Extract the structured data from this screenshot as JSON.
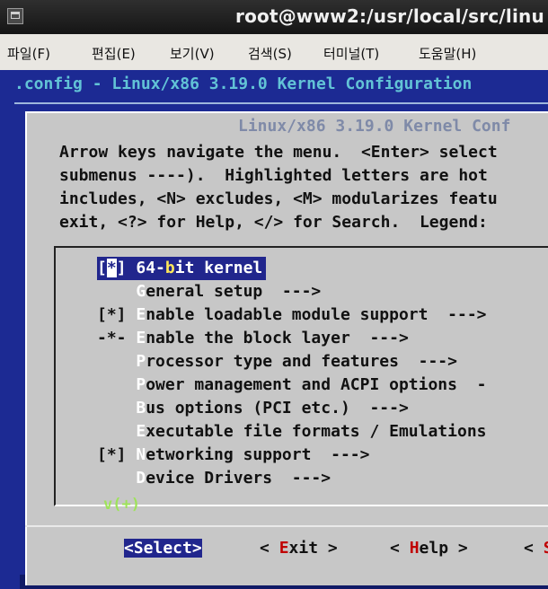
{
  "window": {
    "title": "root@www2:/usr/local/src/linu"
  },
  "menubar": [
    {
      "label": "파일(F)"
    },
    {
      "label": "편집(E)"
    },
    {
      "label": "보기(V)"
    },
    {
      "label": "검색(S)"
    },
    {
      "label": "터미널(T)"
    },
    {
      "label": "도움말(H)"
    }
  ],
  "config_title": ".config - Linux/x86 3.19.0 Kernel Configuration",
  "dialog": {
    "header": "Linux/x86 3.19.0 Kernel Conf",
    "help_lines": [
      "Arrow keys navigate the menu.  <Enter> select",
      "submenus ----).  Highlighted letters are hot",
      "includes, <N> excludes, <M> modularizes featu",
      "exit, <?> for Help, </> for Search.  Legend: "
    ]
  },
  "menu_items": [
    {
      "prefix": "[",
      "cursor": "*",
      "after": "] ",
      "pre": "64-",
      "hk": "b",
      "post": "it kernel",
      "selected": true
    },
    {
      "prefix": "    ",
      "cursor": "",
      "after": "",
      "pre": "",
      "hk": "G",
      "post": "eneral setup  --->",
      "selected": false
    },
    {
      "prefix": "[*] ",
      "cursor": "",
      "after": "",
      "pre": "",
      "hk": "E",
      "post": "nable loadable module support  --->",
      "selected": false
    },
    {
      "prefix": "-*- ",
      "cursor": "",
      "after": "",
      "pre": "",
      "hk": "E",
      "post": "nable the block layer  --->",
      "selected": false
    },
    {
      "prefix": "    ",
      "cursor": "",
      "after": "",
      "pre": "",
      "hk": "P",
      "post": "rocessor type and features  --->",
      "selected": false
    },
    {
      "prefix": "    ",
      "cursor": "",
      "after": "",
      "pre": "",
      "hk": "P",
      "post": "ower management and ACPI options  -",
      "selected": false
    },
    {
      "prefix": "    ",
      "cursor": "",
      "after": "",
      "pre": "",
      "hk": "B",
      "post": "us options (PCI etc.)  --->",
      "selected": false
    },
    {
      "prefix": "    ",
      "cursor": "",
      "after": "",
      "pre": "",
      "hk": "E",
      "post": "xecutable file formats / Emulations",
      "selected": false
    },
    {
      "prefix": "[*] ",
      "cursor": "",
      "after": "",
      "pre": "",
      "hk": "N",
      "post": "etworking support  --->",
      "selected": false
    },
    {
      "prefix": "    ",
      "cursor": "",
      "after": "",
      "pre": "",
      "hk": "D",
      "post": "evice Drivers  --->",
      "selected": false
    }
  ],
  "more_indicator": "v(+)",
  "buttons": {
    "select": "<Select>",
    "exit": {
      "pre": "< ",
      "hk": "E",
      "post": "xit >"
    },
    "help": {
      "pre": "< ",
      "hk": "H",
      "post": "elp >"
    },
    "save": {
      "pre": "< ",
      "hk": "S",
      "post": ""
    }
  }
}
